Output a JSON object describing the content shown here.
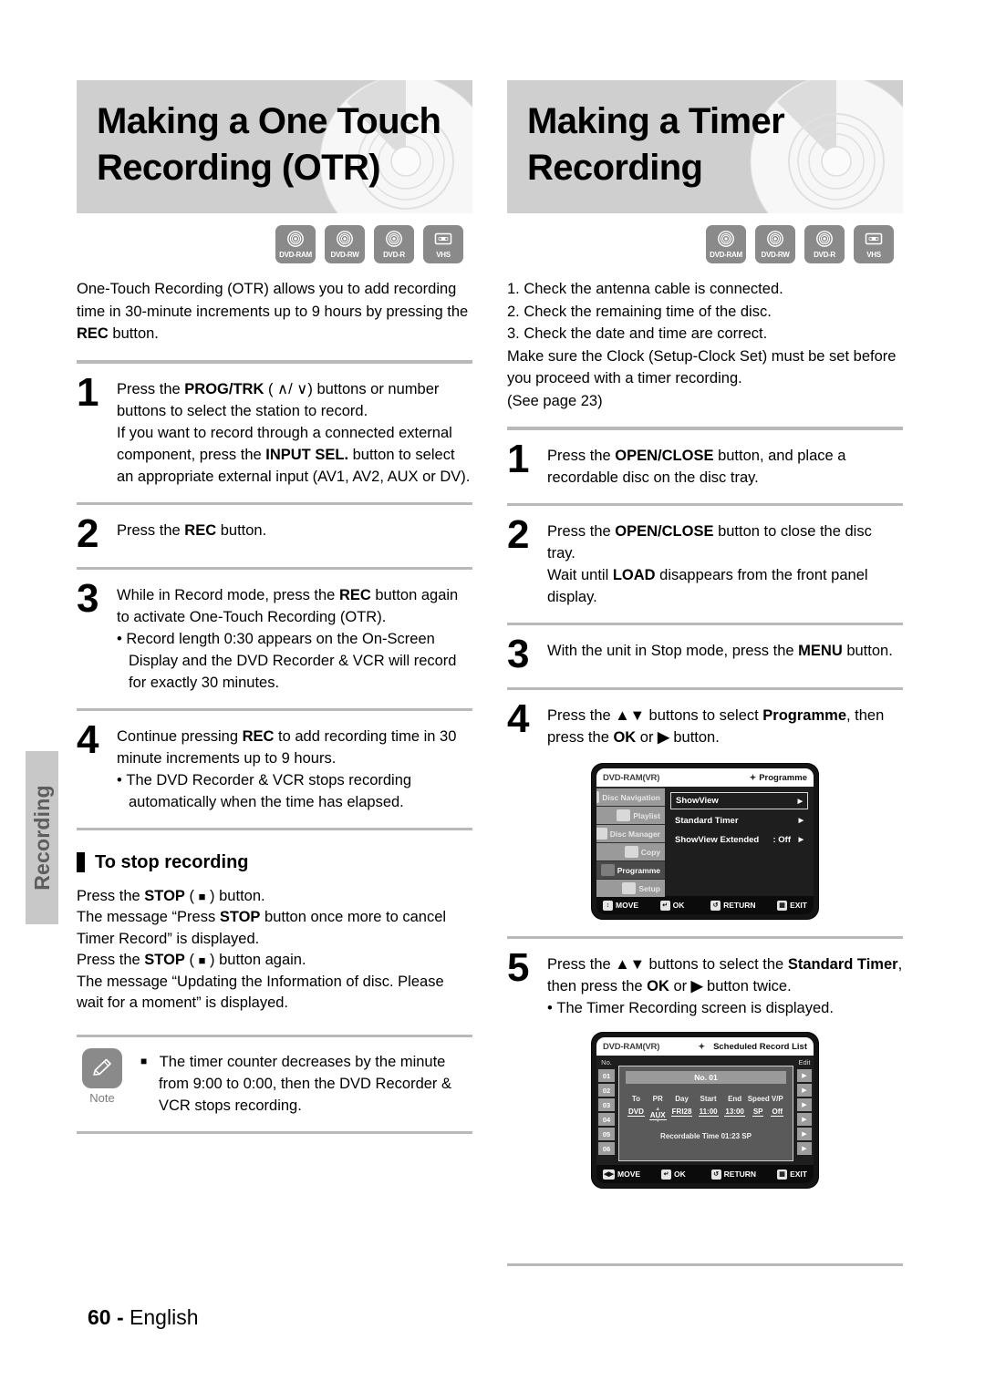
{
  "side_tab": {
    "label": "Recording"
  },
  "footer": {
    "page": "60",
    "dash": "-",
    "language": "English"
  },
  "media_icons": [
    {
      "name": "dvd-ram-icon",
      "caption": "DVD-RAM"
    },
    {
      "name": "dvd-rw-icon",
      "caption": "DVD-RW"
    },
    {
      "name": "dvd-r-icon",
      "caption": "DVD-R"
    },
    {
      "name": "vhs-icon",
      "caption": "VHS"
    }
  ],
  "left": {
    "title_line1": "Making a One Touch",
    "title_line2": "Recording (OTR)",
    "intro": "One-Touch Recording (OTR) allows you to add recording time in 30-minute increments up to 9 hours by pressing the REC button.",
    "steps": [
      {
        "num": "1",
        "lines": [
          "Press the PROG/TRK ( ∧ / ∨) buttons or number buttons to select the station to record.",
          "If you want to record through a connected external component, press the INPUT SEL. button to select an appropriate external input (AV1, AV2, AUX or DV)."
        ]
      },
      {
        "num": "2",
        "lines": [
          "Press the REC button."
        ]
      },
      {
        "num": "3",
        "lines": [
          "While in Record mode, press the REC button again to activate One-Touch Recording (OTR)."
        ],
        "bullets": [
          "Record length 0:30 appears on the On-Screen Display and the DVD Recorder & VCR will record for exactly 30 minutes."
        ]
      },
      {
        "num": "4",
        "lines": [
          "Continue pressing REC to add recording time in 30 minute increments up to 9 hours."
        ],
        "bullets": [
          "The DVD Recorder & VCR stops recording automatically when the time has elapsed."
        ]
      }
    ],
    "section": {
      "heading": "To stop recording",
      "lines": [
        "Press the STOP ( ■ ) button.",
        "The message “Press STOP button once more to cancel Timer Record” is displayed.",
        "Press the STOP ( ■ ) button again.",
        "The message “Updating the Information of disc. Please wait for a moment” is displayed."
      ]
    },
    "note": {
      "caption": "Note",
      "text": "The timer counter decreases by the minute from 9:00 to 0:00, then the DVD Recorder & VCR stops recording."
    }
  },
  "right": {
    "title_line1": "Making a Timer",
    "title_line2": "Recording",
    "checks": [
      "1. Check the antenna cable is connected.",
      "2. Check the remaining time of the disc.",
      "3. Check the date and time are correct."
    ],
    "note_lines": [
      "Make sure the Clock (Setup-Clock Set) must be set before you proceed with a timer recording.",
      "(See page 23)"
    ],
    "steps": [
      {
        "num": "1",
        "lines": [
          "Press the OPEN/CLOSE button, and place a recordable disc on the disc tray."
        ]
      },
      {
        "num": "2",
        "lines": [
          "Press the OPEN/CLOSE button to close the disc tray.",
          "Wait until LOAD disappears from the front panel display."
        ]
      },
      {
        "num": "3",
        "lines": [
          "With the unit in Stop mode, press the MENU button."
        ]
      },
      {
        "num": "4",
        "lines": [
          "Press the ▲▼ buttons to select Programme, then press the OK or ▶ button."
        ]
      },
      {
        "num": "5",
        "lines": [
          "Press the ▲▼ buttons to select the Standard Timer, then press the OK or ▶ button twice."
        ],
        "bullets": [
          "The Timer Recording screen is displayed."
        ]
      }
    ],
    "osd_programme": {
      "disc_label": "DVD-RAM(VR)",
      "title": "Programme",
      "sidebar": [
        {
          "label": "Disc Navigation",
          "icon": "disc-navigation-icon"
        },
        {
          "label": "Playlist",
          "icon": "playlist-icon"
        },
        {
          "label": "Disc Manager",
          "icon": "disc-manager-icon"
        },
        {
          "label": "Copy",
          "icon": "copy-icon"
        },
        {
          "label": "Programme",
          "icon": "programme-icon"
        },
        {
          "label": "Setup",
          "icon": "setup-gear-icon"
        }
      ],
      "rows": [
        {
          "name": "ShowView",
          "value": "",
          "selected": true
        },
        {
          "name": "Standard Timer",
          "value": "",
          "selected": false
        },
        {
          "name": "ShowView Extended",
          "value": ": Off",
          "selected": false
        }
      ],
      "footer": [
        {
          "key": "↕",
          "label": "MOVE"
        },
        {
          "key": "↵",
          "label": "OK"
        },
        {
          "key": "↺",
          "label": "RETURN"
        },
        {
          "key": "▧",
          "label": "EXIT"
        }
      ]
    },
    "osd_schedule": {
      "disc_label": "DVD-RAM(VR)",
      "title": "Scheduled Record List",
      "no_header": "No.",
      "edit_header": "Edit",
      "rows": [
        "01",
        "02",
        "03",
        "04",
        "05",
        "06"
      ],
      "panel_title": "No. 01",
      "columns": [
        "To",
        "PR",
        "Day",
        "Start",
        "End",
        "Speed",
        "V/P"
      ],
      "values": [
        "DVD",
        "AUX",
        "FRI28",
        "11:00",
        "13:00",
        "SP",
        "Off"
      ],
      "recordable": "Recordable Time 01:23 SP",
      "footer": [
        {
          "key": "◀▶",
          "label": "MOVE"
        },
        {
          "key": "↵",
          "label": "OK"
        },
        {
          "key": "↺",
          "label": "RETURN"
        },
        {
          "key": "▧",
          "label": "EXIT"
        }
      ]
    }
  },
  "colors": {
    "banner_bg": "#cfcfcf",
    "rule": "#b9b9b9",
    "icon_gray": "#8a8a8a",
    "side_tab": "#c8c8c8",
    "side_tab_text": "#5d5d5d"
  }
}
